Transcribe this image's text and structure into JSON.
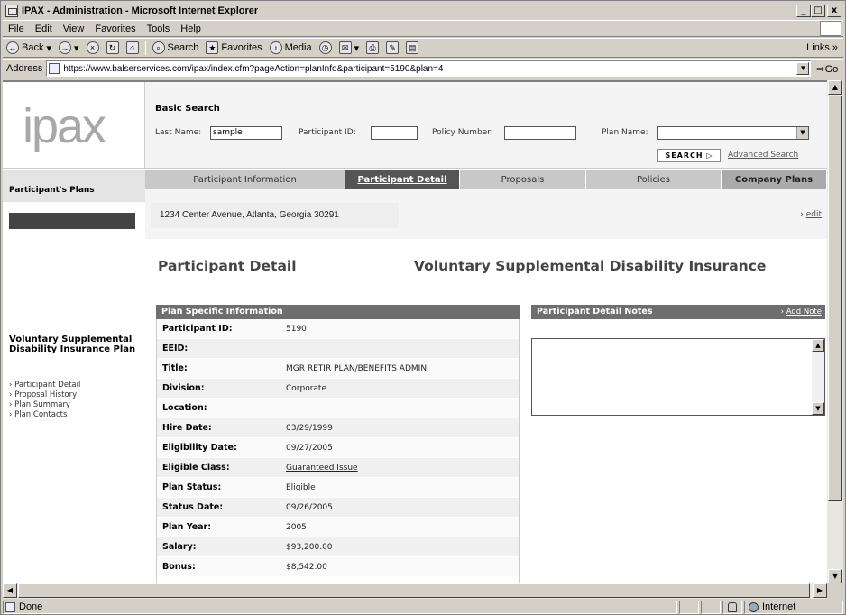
{
  "window": {
    "title": "IPAX - Administration - Microsoft Internet Explorer",
    "min": "_",
    "max": "□",
    "close": "x"
  },
  "menu": [
    "File",
    "Edit",
    "View",
    "Favorites",
    "Tools",
    "Help"
  ],
  "toolbar": {
    "back": "Back",
    "search": "Search",
    "favorites": "Favorites",
    "media": "Media",
    "links": "Links »"
  },
  "address": {
    "label": "Address",
    "url": "https://www.balserservices.com/ipax/index.cfm?pageAction=planInfo&participant=5190&plan=4",
    "go": "Go"
  },
  "logo": "ipax",
  "search": {
    "title": "Basic Search",
    "last_name_label": "Last Name:",
    "last_name_value": "sample",
    "participant_id_label": "Participant ID:",
    "policy_number_label": "Policy Number:",
    "plan_name_label": "Plan Name:",
    "search_button": "SEARCH ▷",
    "advanced": "Advanced Search"
  },
  "sidebar": {
    "header": "Participant's Plans",
    "plan_name": "Voluntary Supplemental Disability Insurance Plan",
    "links": [
      "› Participant Detail",
      "› Proposal History",
      "› Plan Summary",
      "› Plan Contacts"
    ]
  },
  "tabs": [
    "Participant Information",
    "Participant Detail",
    "Proposals",
    "Policies",
    "Company Plans"
  ],
  "participant_address": "1234 Center Avenue, Atlanta, Georgia  30291",
  "edit": "edit",
  "edit_prefix": "› ",
  "page_title": "Participant Detail",
  "plan_title": "Voluntary Supplemental Disability Insurance",
  "plan_info": {
    "header": "Plan Specific Information",
    "rows": [
      {
        "k": "Participant ID:",
        "v": "5190"
      },
      {
        "k": "EEID:",
        "v": ""
      },
      {
        "k": "Title:",
        "v": "MGR RETIR PLAN/BENEFITS ADMIN"
      },
      {
        "k": "Division:",
        "v": "Corporate"
      },
      {
        "k": "Location:",
        "v": ""
      },
      {
        "k": "Hire Date:",
        "v": "03/29/1999"
      },
      {
        "k": "Eligibility Date:",
        "v": "09/27/2005"
      },
      {
        "k": "Eligible Class:",
        "v": "Guaranteed Issue"
      },
      {
        "k": "Plan Status:",
        "v": "Eligible"
      },
      {
        "k": "Status Date:",
        "v": "09/26/2005"
      },
      {
        "k": "Plan Year:",
        "v": "2005"
      },
      {
        "k": "Salary:",
        "v": "$93,200.00"
      },
      {
        "k": "Bonus:",
        "v": "$8,542.00"
      }
    ]
  },
  "notes": {
    "header": "Participant Detail Notes",
    "add_prefix": "› ",
    "add": "Add Note"
  },
  "status": {
    "text": "Done",
    "zone": "Internet"
  }
}
